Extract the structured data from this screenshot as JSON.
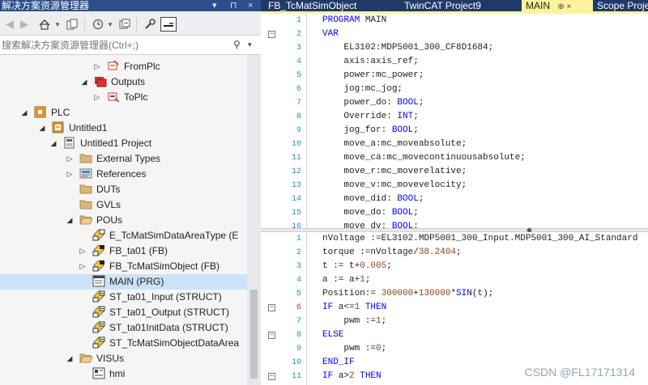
{
  "explorer": {
    "title": "解决方案资源管理器",
    "title_controls": [
      "▾",
      "⊓",
      "×"
    ],
    "search_placeholder": "搜索解决方案资源管理器(Ctrl+;)",
    "tree": [
      {
        "label": "FromPlc",
        "indent": 2,
        "arrow": "collapsed",
        "icon": "input-link-icon"
      },
      {
        "label": "Outputs",
        "indent": 1,
        "arrow": "expanded",
        "icon": "outputs-folder-icon"
      },
      {
        "label": "ToPlc",
        "indent": 2,
        "arrow": "collapsed",
        "icon": "output-link-icon"
      },
      {
        "label": "PLC",
        "indent": -1,
        "arrow": "expanded",
        "icon": "plc-icon"
      },
      {
        "label": "Untitled1",
        "indent": 0,
        "arrow": "expanded",
        "icon": "plc-project-icon"
      },
      {
        "label": "Untitled1 Project",
        "indent": 1,
        "arrow": "expanded",
        "icon": "project-icon"
      },
      {
        "label": "External Types",
        "indent": 2,
        "arrow": "collapsed",
        "icon": "folder-icon"
      },
      {
        "label": "References",
        "indent": 2,
        "arrow": "collapsed",
        "icon": "references-icon"
      },
      {
        "label": "DUTs",
        "indent": 2,
        "arrow": "none",
        "icon": "folder-icon"
      },
      {
        "label": "GVLs",
        "indent": 2,
        "arrow": "none",
        "icon": "folder-icon"
      },
      {
        "label": "POUs",
        "indent": 2,
        "arrow": "expanded",
        "icon": "folder-open-icon"
      },
      {
        "label": "E_TcMatSimDataAreaType (E",
        "indent": 3,
        "arrow": "none",
        "icon": "enum-icon"
      },
      {
        "label": "FB_ta01 (FB)",
        "indent": 3,
        "arrow": "collapsed",
        "icon": "function-block-icon"
      },
      {
        "label": "FB_TcMatSimObject (FB)",
        "indent": 3,
        "arrow": "collapsed",
        "icon": "function-block-icon"
      },
      {
        "label": "MAIN (PRG)",
        "indent": 3,
        "arrow": "none",
        "icon": "program-icon",
        "selected": true
      },
      {
        "label": "ST_ta01_Input (STRUCT)",
        "indent": 3,
        "arrow": "none",
        "icon": "struct-icon"
      },
      {
        "label": "ST_ta01_Output (STRUCT)",
        "indent": 3,
        "arrow": "none",
        "icon": "struct-icon"
      },
      {
        "label": "ST_ta01InitData (STRUCT)",
        "indent": 3,
        "arrow": "none",
        "icon": "struct-icon"
      },
      {
        "label": "ST_TcMatSimObjectDataArea",
        "indent": 3,
        "arrow": "none",
        "icon": "struct-icon"
      },
      {
        "label": "VISUs",
        "indent": 2,
        "arrow": "expanded",
        "icon": "folder-open-icon"
      },
      {
        "label": "hmi",
        "indent": 3,
        "arrow": "none",
        "icon": "visualization-icon"
      }
    ]
  },
  "editor": {
    "tabs": [
      {
        "label": "FB_TcMatSimObject",
        "active": false
      },
      {
        "label": "TwinCAT Project9",
        "active": false
      },
      {
        "label": "MAIN",
        "active": true,
        "controls": "⊕ ×"
      },
      {
        "label": "Scope Proje",
        "active": false
      }
    ],
    "declaration": [
      {
        "n": "1",
        "code": "PROGRAM MAIN",
        "fold": ""
      },
      {
        "n": "2",
        "code": "VAR",
        "fold": "−"
      },
      {
        "n": "3",
        "code": "    EL3102:MDP5001_300_CF8D1684;",
        "fold": ""
      },
      {
        "n": "4",
        "code": "    axis:axis_ref;",
        "fold": ""
      },
      {
        "n": "5",
        "code": "    power:mc_power;",
        "fold": ""
      },
      {
        "n": "6",
        "code": "    jog:mc_jog;",
        "fold": ""
      },
      {
        "n": "7",
        "code": "    power_do: BOOL;",
        "fold": ""
      },
      {
        "n": "8",
        "code": "    Override: INT;",
        "fold": ""
      },
      {
        "n": "9",
        "code": "    jog_for: BOOL;",
        "fold": ""
      },
      {
        "n": "10",
        "code": "    move_a:mc_moveabsolute;",
        "fold": ""
      },
      {
        "n": "11",
        "code": "    move_ca:mc_movecontinuousabsolute;",
        "fold": ""
      },
      {
        "n": "12",
        "code": "    move_r:mc_moverelative;",
        "fold": ""
      },
      {
        "n": "13",
        "code": "    move_v:mc_movevelocity;",
        "fold": ""
      },
      {
        "n": "14",
        "code": "    move_did: BOOL;",
        "fold": ""
      },
      {
        "n": "15",
        "code": "    move_do: BOOL;",
        "fold": ""
      },
      {
        "n": "16",
        "code": "    move_dv: BOOL;",
        "fold": ""
      }
    ],
    "implementation": [
      {
        "n": "1",
        "code": "nVoltage :=EL3102.MDP5001_300_Input.MDP5001_300_AI_Standard",
        "fold": ""
      },
      {
        "n": "2",
        "code": "torque :=nVoltage/38.2404;",
        "fold": ""
      },
      {
        "n": "3",
        "code": "t := t+0.005;",
        "fold": ""
      },
      {
        "n": "4",
        "code": "a := a+1;",
        "fold": ""
      },
      {
        "n": "5",
        "code": "Position:= 300000+130000*SIN(t);",
        "fold": ""
      },
      {
        "n": "6",
        "code": "IF a<=1 THEN",
        "fold": "−"
      },
      {
        "n": "7",
        "code": "    pwm :=1;",
        "fold": ""
      },
      {
        "n": "8",
        "code": "ELSE",
        "fold": "−"
      },
      {
        "n": "9",
        "code": "    pwm :=0;",
        "fold": ""
      },
      {
        "n": "10",
        "code": "END_IF",
        "fold": ""
      },
      {
        "n": "11",
        "code": "IF a>2 THEN",
        "fold": "−"
      }
    ]
  },
  "watermark": "CSDN @FL17171314",
  "colors": {
    "title_bar": "#2b4f8c",
    "tab_strip": "#1f3a68",
    "active_tab": "#fff29d",
    "selection": "#cce2f7",
    "keyword": "#0000ff",
    "line_number": "#2b91af",
    "number_literal": "#8b4513"
  }
}
